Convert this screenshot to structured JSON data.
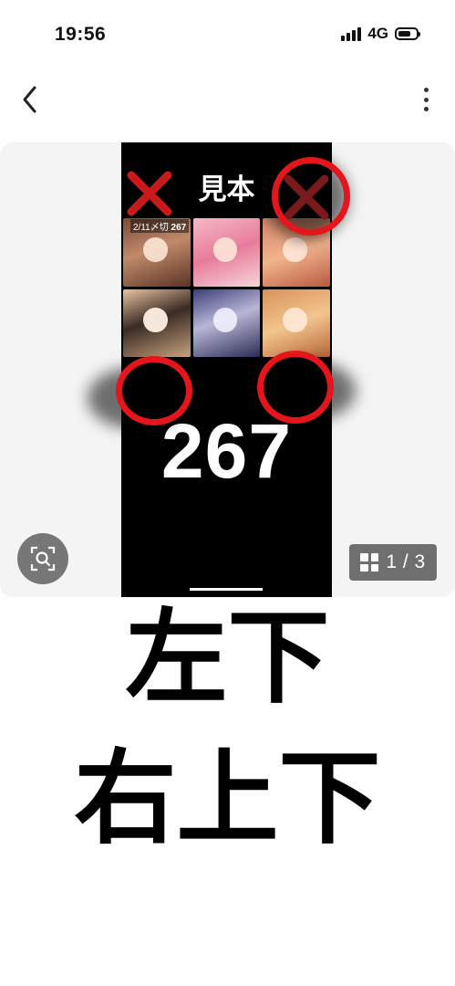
{
  "status_bar": {
    "time": "19:56",
    "network": "4G"
  },
  "poster": {
    "title": "見本",
    "date_tag": "2/11〆切",
    "tag_number": "267",
    "number": "267"
  },
  "gallery": {
    "page_indicator": "1 / 3"
  },
  "caption": {
    "line1": "左下",
    "line2": "右上下"
  },
  "colors": {
    "accent_red": "#e4161c",
    "pager_bg": "#6f6f6f",
    "gallery_bg": "#f4f4f4"
  },
  "icons": [
    "back-icon",
    "more-icon",
    "lens-search-icon",
    "grid-icon",
    "x-mark-icon",
    "circle-mark-icon"
  ]
}
